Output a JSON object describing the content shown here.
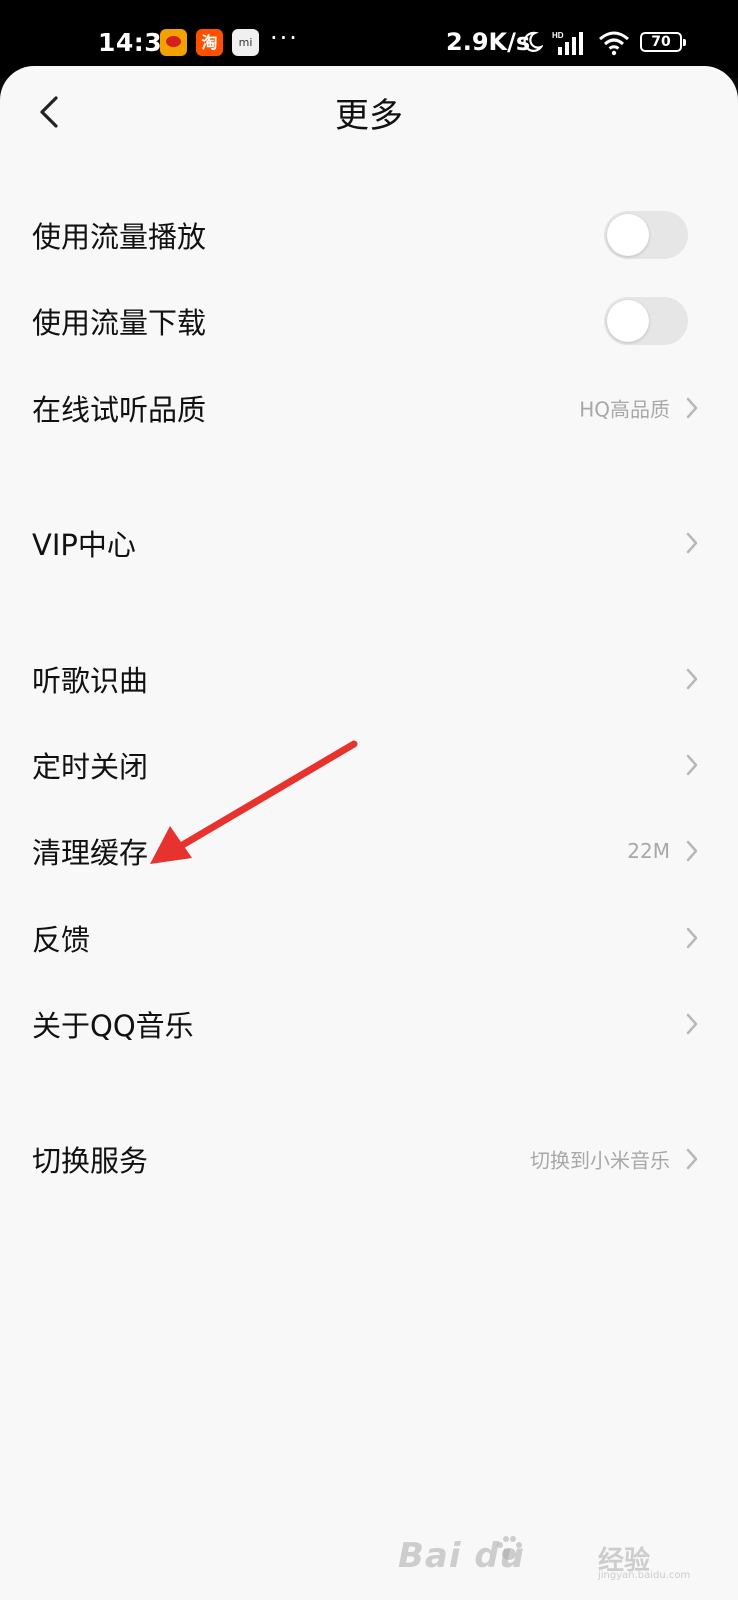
{
  "status_bar": {
    "time": "14:33",
    "apps": [
      "weibo-icon",
      "taobao-icon",
      "mi-store-icon"
    ],
    "taobao_glyph": "淘",
    "mi_glyph": "mi",
    "more": "···",
    "net_speed": "2.9K/s",
    "battery": "70"
  },
  "header": {
    "title": "更多",
    "back_icon": "chevron-left-icon"
  },
  "groups": [
    {
      "items": [
        {
          "label": "使用流量播放",
          "control": "toggle",
          "on": false
        },
        {
          "label": "使用流量下载",
          "control": "toggle",
          "on": false
        },
        {
          "label": "在线试听品质",
          "value": "HQ高品质",
          "control": "chevron"
        }
      ]
    },
    {
      "items": [
        {
          "label": "VIP中心",
          "control": "chevron"
        }
      ]
    },
    {
      "items": [
        {
          "label": "听歌识曲",
          "control": "chevron"
        },
        {
          "label": "定时关闭",
          "control": "chevron"
        },
        {
          "label": "清理缓存",
          "value": "22M",
          "control": "chevron"
        },
        {
          "label": "反馈",
          "control": "chevron"
        },
        {
          "label": "关于QQ音乐",
          "control": "chevron"
        }
      ]
    },
    {
      "items": [
        {
          "label": "切换服务",
          "value": "切换到小米音乐",
          "control": "chevron"
        }
      ]
    }
  ],
  "annotation": {
    "arrow_color": "#e8322e",
    "points_to": "清理缓存"
  },
  "watermark": {
    "brand": "Bai  du",
    "cn": "经验",
    "sub": "jingyan.baidu.com"
  }
}
